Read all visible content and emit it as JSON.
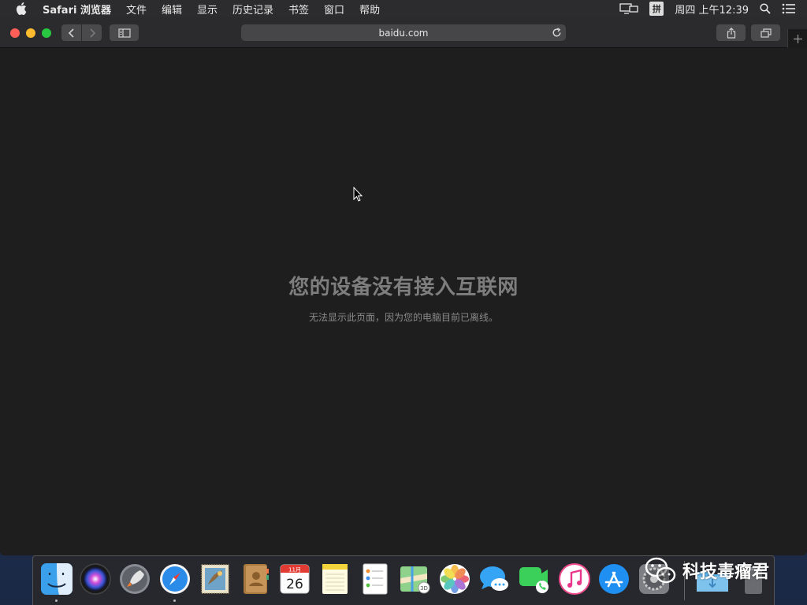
{
  "menubar": {
    "app_name": "Safari 浏览器",
    "items": [
      "文件",
      "编辑",
      "显示",
      "历史记录",
      "书签",
      "窗口",
      "帮助"
    ],
    "ime": "拼",
    "clock": "周四 上午12:39"
  },
  "browser": {
    "url": "baidu.com"
  },
  "page": {
    "error_title": "您的设备没有接入互联网",
    "error_subtitle": "无法显示此页面，因为您的电脑目前已离线。"
  },
  "calendar_icon": {
    "month": "11月",
    "day": "26"
  },
  "dock": {
    "apps": [
      "finder-icon",
      "siri-icon",
      "launchpad-icon",
      "safari-icon",
      "mail-icon",
      "contacts-icon",
      "calendar-icon",
      "notes-icon",
      "reminders-icon",
      "maps-icon",
      "photos-icon",
      "messages-icon",
      "facetime-icon",
      "itunes-icon",
      "app-store-icon",
      "system-preferences-icon",
      "downloads-folder-icon",
      "trash-icon"
    ]
  },
  "watermark": {
    "text": "科技毒瘤君"
  },
  "colors": {
    "close": "#ff5f57",
    "minimize": "#febc2e",
    "maximize": "#28c840",
    "window_bg": "#1e1e1e"
  }
}
